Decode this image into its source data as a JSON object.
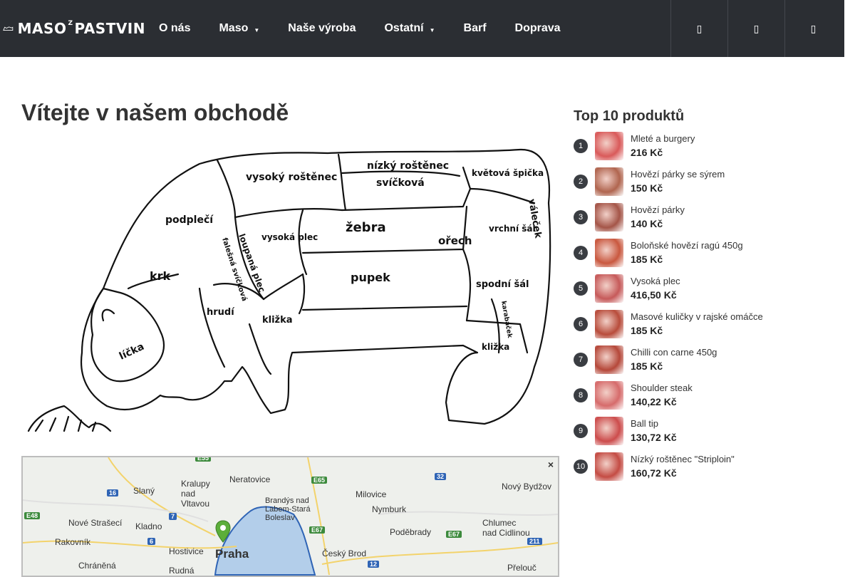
{
  "header": {
    "logo": "MASO Z PASTVIN",
    "logo_parts": [
      "MASO",
      "Z",
      "PASTVIN"
    ],
    "nav": [
      {
        "label": "O nás",
        "dropdown": false
      },
      {
        "label": "Maso",
        "dropdown": true
      },
      {
        "label": "Naše výroba",
        "dropdown": false
      },
      {
        "label": "Ostatní",
        "dropdown": true
      },
      {
        "label": "Barf",
        "dropdown": false
      },
      {
        "label": "Doprava",
        "dropdown": false
      }
    ],
    "icons": [
      "search-icon",
      "user-icon",
      "cart-icon"
    ]
  },
  "main": {
    "title": "Vítejte v našem obchodě",
    "cuts": [
      "nízký roštěnec",
      "svíčková",
      "vysoký roštěnec",
      "květová špička",
      "podplečí",
      "loupaná plec",
      "falešná svíčková",
      "vysoká plec",
      "žebra",
      "ořech",
      "vrchní šál",
      "váleček",
      "krk",
      "pupek",
      "spodní šál",
      "hrudí",
      "kližka",
      "karabáček",
      "kližka",
      "líčka"
    ]
  },
  "map": {
    "close": "×",
    "labels": [
      "Neratovice",
      "Kralupy nad Vltavou",
      "Slaný",
      "Brandýs nad Labem-Stará Boleslav",
      "Milovice",
      "Nový Bydžov",
      "Nymburk",
      "Chlumec nad Cidlinou",
      "Nové Strašecí",
      "Kladno",
      "Poděbrady",
      "Rakovník",
      "Hostivice",
      "Praha",
      "Český Brod",
      "Chráněná",
      "Přelouč",
      "Rudná"
    ],
    "roads": [
      "E55",
      "E65",
      "32",
      "16",
      "7",
      "E48",
      "6",
      "E67",
      "E67",
      "211",
      "12"
    ]
  },
  "sidebar": {
    "title": "Top 10 produktů",
    "products": [
      {
        "rank": "1",
        "name": "Mleté a burgery",
        "price": "216 Kč",
        "thumb": "#d95a5a"
      },
      {
        "rank": "2",
        "name": "Hovězí párky se sýrem",
        "price": "150 Kč",
        "thumb": "#b0654f"
      },
      {
        "rank": "3",
        "name": "Hovězí párky",
        "price": "140 Kč",
        "thumb": "#a45548"
      },
      {
        "rank": "4",
        "name": "Boloňské hovězí ragú 450g",
        "price": "185 Kč",
        "thumb": "#c9583f"
      },
      {
        "rank": "5",
        "name": "Vysoká plec",
        "price": "416,50 Kč",
        "thumb": "#c65a5a"
      },
      {
        "rank": "6",
        "name": "Masové kuličky v rajské omáčce",
        "price": "185 Kč",
        "thumb": "#b84c3b"
      },
      {
        "rank": "7",
        "name": "Chilli con carne 450g",
        "price": "185 Kč",
        "thumb": "#b5483a"
      },
      {
        "rank": "8",
        "name": "Shoulder steak",
        "price": "140,22 Kč",
        "thumb": "#d66b6b"
      },
      {
        "rank": "9",
        "name": "Ball tip",
        "price": "130,72 Kč",
        "thumb": "#cc4c4c"
      },
      {
        "rank": "10",
        "name": "Nízký roštěnec \"Striploin\"",
        "price": "160,72 Kč",
        "thumb": "#c44c44"
      }
    ]
  }
}
